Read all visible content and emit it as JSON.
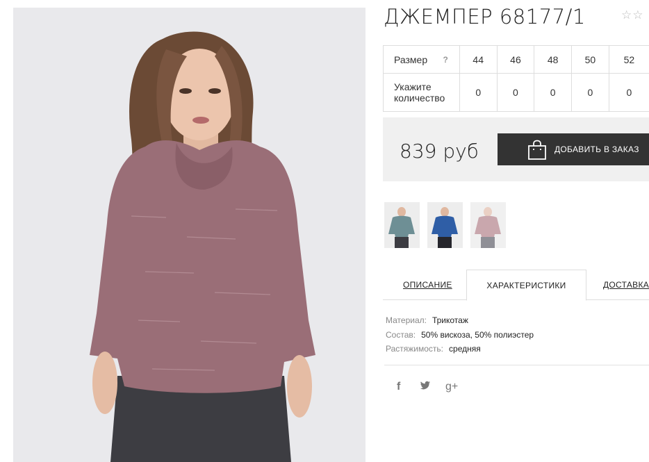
{
  "product": {
    "title": "ДЖЕМПЕР 68177/1",
    "rating_stars": "☆☆"
  },
  "sizes": {
    "size_label": "Размер",
    "help": "?",
    "quantity_label": "Укажите количество",
    "columns": [
      "44",
      "46",
      "48",
      "50",
      "52"
    ],
    "quantities": [
      "0",
      "0",
      "0",
      "0",
      "0"
    ]
  },
  "purchase": {
    "price": "839 руб",
    "add_to_order": "ДОБАВИТЬ В ЗАКАЗ"
  },
  "tabs": [
    {
      "label": "ОПИСАНИЕ",
      "active": false
    },
    {
      "label": "ХАРАКТЕРИСТИКИ",
      "active": true
    },
    {
      "label": "ДОСТАВКА",
      "active": false
    }
  ],
  "specs": [
    {
      "label": "Материал:",
      "value": "Трикотаж"
    },
    {
      "label": "Состав:",
      "value": "50% вискоза, 50% полиэстер"
    },
    {
      "label": "Растяжимость:",
      "value": "средняя"
    }
  ],
  "social": {
    "facebook": "f",
    "twitter": "t",
    "google_plus": "g+"
  },
  "colors": {
    "photo_background": "#e9e9ec",
    "sweater": "#9a6e77",
    "thumb_teal": "#6e8f95",
    "thumb_blue": "#2f5ea6",
    "thumb_pink": "#c9a7ad",
    "button_dark": "#333333"
  }
}
